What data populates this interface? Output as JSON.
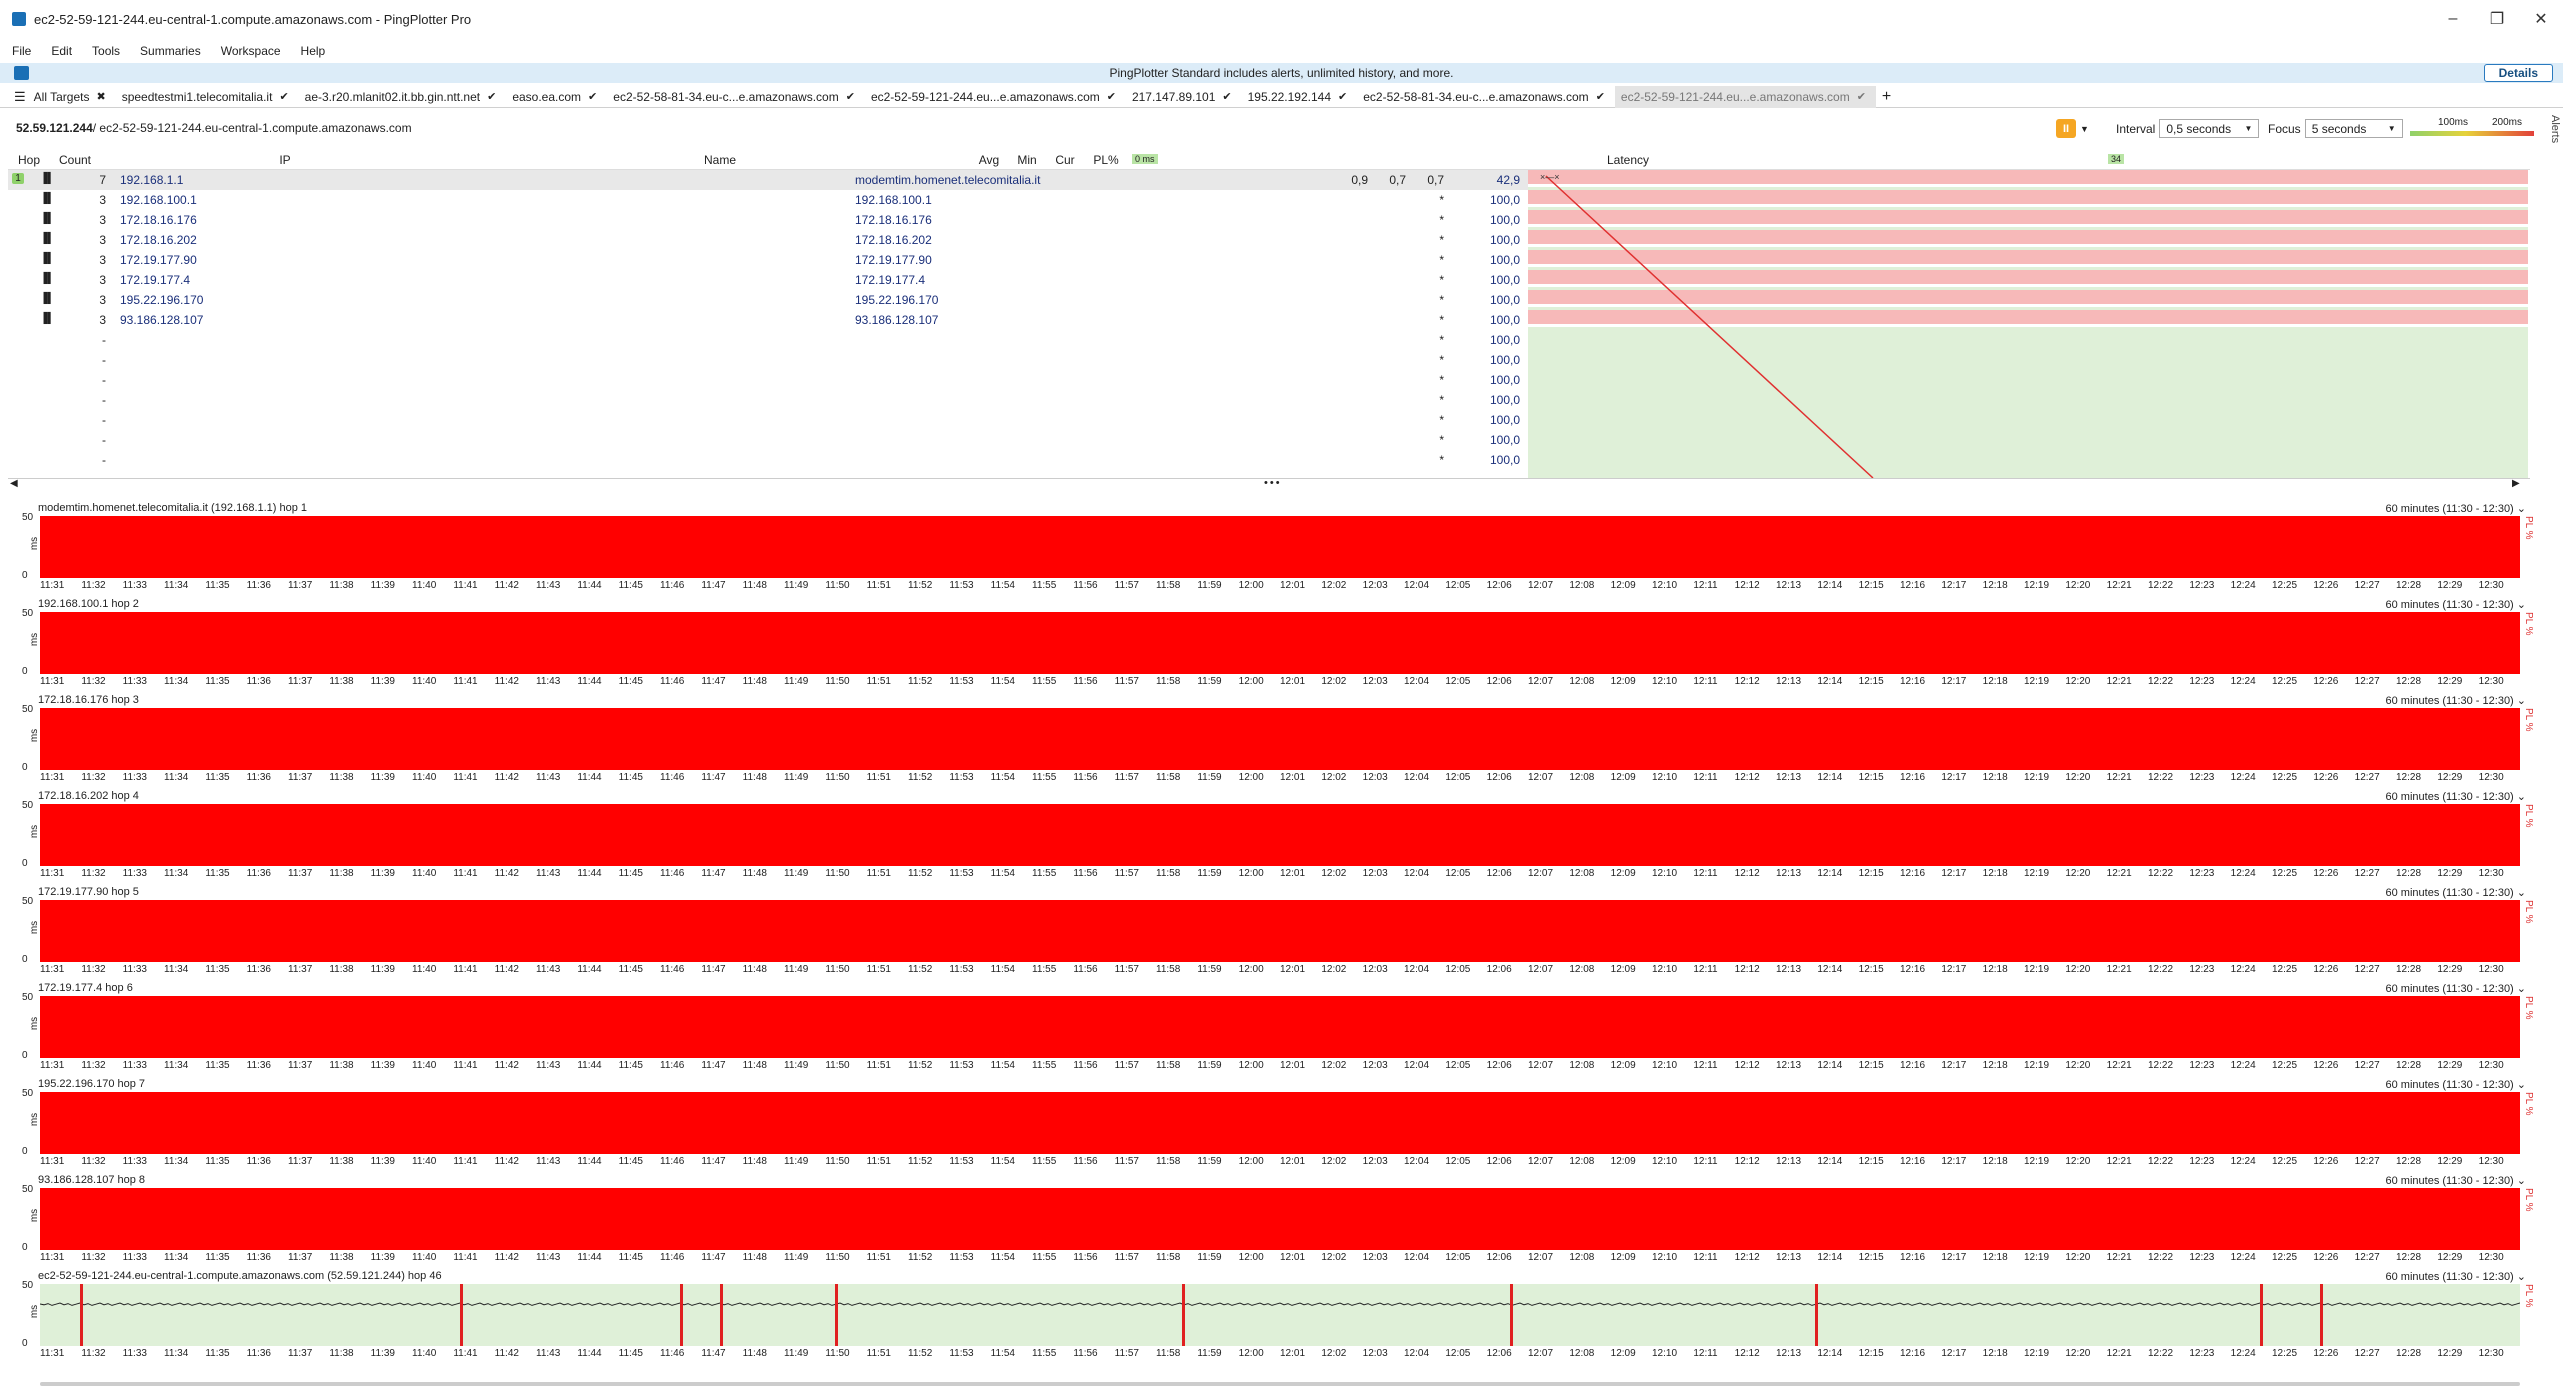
{
  "window": {
    "title": "ec2-52-59-121-244.eu-central-1.compute.amazonaws.com - PingPlotter Pro"
  },
  "menu": [
    "File",
    "Edit",
    "Tools",
    "Summaries",
    "Workspace",
    "Help"
  ],
  "promo": {
    "text": "PingPlotter Standard includes alerts, unlimited history, and more.",
    "button": "Details"
  },
  "tabs": [
    {
      "label": "All Targets",
      "mark": "✖"
    },
    {
      "label": "speedtestmi1.telecomitalia.it",
      "mark": "✔"
    },
    {
      "label": "ae-3.r20.mlanit02.it.bb.gin.ntt.net",
      "mark": "✔"
    },
    {
      "label": "easo.ea.com",
      "mark": "✔"
    },
    {
      "label": "ec2-52-58-81-34.eu-c...e.amazonaws.com",
      "mark": "✔"
    },
    {
      "label": "ec2-52-59-121-244.eu...e.amazonaws.com",
      "mark": "✔"
    },
    {
      "label": "217.147.89.101",
      "mark": "✔"
    },
    {
      "label": "195.22.192.144",
      "mark": "✔"
    },
    {
      "label": "ec2-52-58-81-34.eu-c...e.amazonaws.com",
      "mark": "✔"
    },
    {
      "label": "ec2-52-59-121-244.eu...e.amazonaws.com",
      "mark": "✔"
    }
  ],
  "crumb": {
    "ip": "52.59.121.244",
    "path": " / ec2-52-59-121-244.eu-central-1.compute.amazonaws.com"
  },
  "controls": {
    "interval_label": "Interval",
    "interval": "0,5 seconds",
    "focus_label": "Focus",
    "focus": "5 seconds",
    "scale_a": "100ms",
    "scale_b": "200ms",
    "alerts": "Alerts"
  },
  "grid": {
    "headers": {
      "hop": "Hop",
      "count": "Count",
      "ip": "IP",
      "name": "Name",
      "avg": "Avg",
      "min": "Min",
      "cur": "Cur",
      "pl": "PL%",
      "latency": "Latency",
      "zero": "0 ms",
      "max": "34"
    },
    "rows": [
      {
        "hop": "1",
        "count": "7",
        "ip": "192.168.1.1",
        "name": "modemtim.homenet.telecomitalia.it",
        "avg": "0,9",
        "min": "0,7",
        "cur": "0,7",
        "pl": "42,9"
      },
      {
        "hop": "",
        "count": "3",
        "ip": "192.168.100.1",
        "name": "192.168.100.1",
        "avg": "",
        "min": "",
        "cur": "*",
        "pl": "100,0"
      },
      {
        "hop": "",
        "count": "3",
        "ip": "172.18.16.176",
        "name": "172.18.16.176",
        "avg": "",
        "min": "",
        "cur": "*",
        "pl": "100,0"
      },
      {
        "hop": "",
        "count": "3",
        "ip": "172.18.16.202",
        "name": "172.18.16.202",
        "avg": "",
        "min": "",
        "cur": "*",
        "pl": "100,0"
      },
      {
        "hop": "",
        "count": "3",
        "ip": "172.19.177.90",
        "name": "172.19.177.90",
        "avg": "",
        "min": "",
        "cur": "*",
        "pl": "100,0"
      },
      {
        "hop": "",
        "count": "3",
        "ip": "172.19.177.4",
        "name": "172.19.177.4",
        "avg": "",
        "min": "",
        "cur": "*",
        "pl": "100,0"
      },
      {
        "hop": "",
        "count": "3",
        "ip": "195.22.196.170",
        "name": "195.22.196.170",
        "avg": "",
        "min": "",
        "cur": "*",
        "pl": "100,0"
      },
      {
        "hop": "",
        "count": "3",
        "ip": "93.186.128.107",
        "name": "93.186.128.107",
        "avg": "",
        "min": "",
        "cur": "*",
        "pl": "100,0"
      },
      {
        "hop": "",
        "count": "-",
        "ip": "",
        "name": "",
        "avg": "",
        "min": "",
        "cur": "*",
        "pl": "100,0"
      },
      {
        "hop": "",
        "count": "-",
        "ip": "",
        "name": "",
        "avg": "",
        "min": "",
        "cur": "*",
        "pl": "100,0"
      },
      {
        "hop": "",
        "count": "-",
        "ip": "",
        "name": "",
        "avg": "",
        "min": "",
        "cur": "*",
        "pl": "100,0"
      },
      {
        "hop": "",
        "count": "-",
        "ip": "",
        "name": "",
        "avg": "",
        "min": "",
        "cur": "*",
        "pl": "100,0"
      },
      {
        "hop": "",
        "count": "-",
        "ip": "",
        "name": "",
        "avg": "",
        "min": "",
        "cur": "*",
        "pl": "100,0"
      },
      {
        "hop": "",
        "count": "-",
        "ip": "",
        "name": "",
        "avg": "",
        "min": "",
        "cur": "*",
        "pl": "100,0"
      },
      {
        "hop": "",
        "count": "-",
        "ip": "",
        "name": "",
        "avg": "",
        "min": "",
        "cur": "*",
        "pl": "100,0"
      }
    ]
  },
  "panels": [
    {
      "title": "modemtim.homenet.telecomitalia.it (192.168.1.1) hop 1",
      "range": "60 minutes (11:30 - 12:30)",
      "ok": false
    },
    {
      "title": "192.168.100.1 hop 2",
      "range": "60 minutes (11:30 - 12:30)",
      "ok": false
    },
    {
      "title": "172.18.16.176 hop 3",
      "range": "60 minutes (11:30 - 12:30)",
      "ok": false
    },
    {
      "title": "172.18.16.202 hop 4",
      "range": "60 minutes (11:30 - 12:30)",
      "ok": false
    },
    {
      "title": "172.19.177.90 hop 5",
      "range": "60 minutes (11:30 - 12:30)",
      "ok": false
    },
    {
      "title": "172.19.177.4 hop 6",
      "range": "60 minutes (11:30 - 12:30)",
      "ok": false
    },
    {
      "title": "195.22.196.170 hop 7",
      "range": "60 minutes (11:30 - 12:30)",
      "ok": false
    },
    {
      "title": "93.186.128.107 hop 8",
      "range": "60 minutes (11:30 - 12:30)",
      "ok": false
    },
    {
      "title": "ec2-52-59-121-244.eu-central-1.compute.amazonaws.com (52.59.121.244) hop 46",
      "range": "60 minutes (11:30 - 12:30)",
      "ok": true
    }
  ],
  "axis": {
    "y_top": "50",
    "y_bottom": "0",
    "unit": "ms",
    "pl_label": "PL %",
    "times": [
      "11:31",
      "11:32",
      "11:33",
      "11:34",
      "11:35",
      "11:36",
      "11:37",
      "11:38",
      "11:39",
      "11:40",
      "11:41",
      "11:42",
      "11:43",
      "11:44",
      "11:45",
      "11:46",
      "11:47",
      "11:48",
      "11:49",
      "11:50",
      "11:51",
      "11:52",
      "11:53",
      "11:54",
      "11:55",
      "11:56",
      "11:57",
      "11:58",
      "11:59",
      "12:00",
      "12:01",
      "12:02",
      "12:03",
      "12:04",
      "12:05",
      "12:06",
      "12:07",
      "12:08",
      "12:09",
      "12:10",
      "12:11",
      "12:12",
      "12:13",
      "12:14",
      "12:15",
      "12:16",
      "12:17",
      "12:18",
      "12:19",
      "12:20",
      "12:21",
      "12:22",
      "12:23",
      "12:24",
      "12:25",
      "12:26",
      "12:27",
      "12:28",
      "12:29",
      "12:30"
    ]
  }
}
